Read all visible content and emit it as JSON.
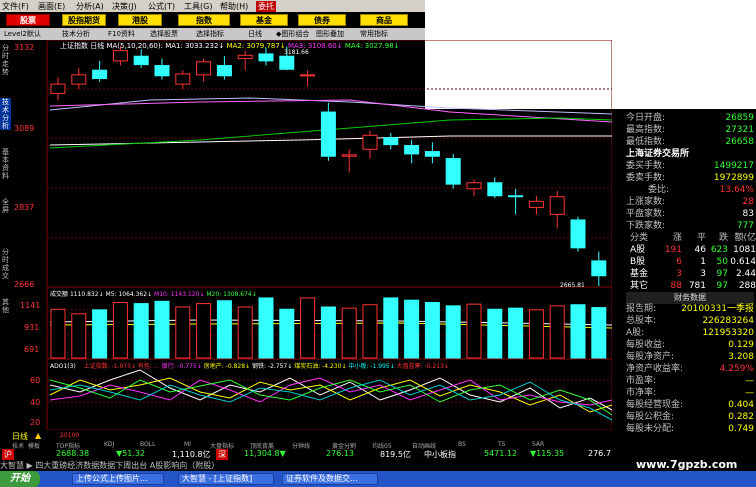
{
  "menu": [
    "文件(F)",
    "画面(E)",
    "分析(A)",
    "决策(J)",
    "公式(T)",
    "工具(G)",
    "帮助(H)",
    "委托"
  ],
  "tabs": [
    "股票",
    "股指期货",
    "港股",
    "指数",
    "基金",
    "债券",
    "商品"
  ],
  "toolbar": [
    "Level2默认",
    "技术分析",
    "F10资料",
    "选择股票",
    "选择指标",
    "日线",
    "◆图形组合",
    "图形叠加",
    "常用指标"
  ],
  "sidebar": [
    "分时走势",
    "技术分析",
    "基本资料",
    "全屏",
    "分时成交",
    "其他"
  ],
  "price_header": {
    "name": "上证指数",
    "period": "日线",
    "ma_label": "MA(5,10,20,60):",
    "ma1": "MA1: 3033.232↓",
    "ma2": "MA2: 3079.787↓",
    "ma3": "MA3: 3108.60↓",
    "ma4": "MA4: 3027.98↓",
    "high_mark": "3181.66",
    "low_mark": "2665.81"
  },
  "price_axis": [
    "3132",
    "3089",
    "2837",
    "2666"
  ],
  "volume_header": {
    "label": "成交额",
    "v1": "1110.832↓",
    "ma5": "M5: 1064.362↓",
    "ma10": "M10: 1143.120↓",
    "ma20": "M20: 1308.674↓"
  },
  "volume_axis": [
    "1141",
    "931",
    "691"
  ],
  "adl_header": {
    "label": "ADO1(3)",
    "items": [
      "上证指数: -1.973↓",
      "有色: ...",
      "银行: -0.775↓",
      "房地产: -0.828↓",
      "钢铁: -2.757↓",
      "煤炭石油: -4.230↓",
      "中小板: -1.995↓",
      "大盘蓝筹: -5.213↓"
    ]
  },
  "adl_axis": [
    "60",
    "40",
    "20"
  ],
  "bottom_date": "日线",
  "bottom_date2": "20100",
  "bottom_tabs": [
    "技术",
    "模板",
    "TOP指标",
    "KDJ",
    "BOLL",
    "MI",
    "大盘指标",
    "顶底背离",
    "分钟线",
    "黄金分割",
    "均线05",
    "自动画线",
    "BS",
    "TS",
    "SAR"
  ],
  "ticker": {
    "sh_label": "沪",
    "sh_val": "2688.38",
    "sh_chg": "▼51.32",
    "sh_amt": "1,110.8亿",
    "sz_label": "深",
    "sz_val": "11,304.8▼",
    "sz_chg": "276.13",
    "sz_amt": "819.5亿",
    "sme_label": "中小板指",
    "sme_val": "5471.12",
    "sme_chg": "▼115.35",
    "sme_amt": "276.7"
  },
  "news": "大智慧  ▶ 四大重磅经济数据数据下周出台 A股影响向（附股）",
  "right_panel": {
    "rows": [
      {
        "label": "今日开盘:",
        "value": "26859"
      },
      {
        "label": "最高指数:",
        "value": "27321"
      },
      {
        "label": "最低指数:",
        "value": "26658"
      }
    ],
    "exchange": "上海证券交易所",
    "rows2": [
      {
        "label": "委买手数:",
        "value": "1499217"
      },
      {
        "label": "委卖手数:",
        "value": "1972899"
      },
      {
        "label": "委比:",
        "value": "13.64%"
      },
      {
        "label": "上涨家数:",
        "value": "28"
      },
      {
        "label": "平盘家数:",
        "value": "83"
      },
      {
        "label": "下跌家数:",
        "value": "777"
      }
    ],
    "table_head": [
      "分类",
      "涨",
      "平",
      "跌",
      "额(亿"
    ],
    "table_rows": [
      [
        "A股",
        "191",
        "46",
        "623",
        "1081"
      ],
      [
        "B股",
        "6",
        "1",
        "50",
        "0.614"
      ],
      [
        "基金",
        "3",
        "3",
        "97",
        "2.44"
      ],
      [
        "其它",
        "88",
        "781",
        "97",
        "288"
      ]
    ],
    "fin_title": "财务数据",
    "fin_rows": [
      {
        "label": "报告期:",
        "value": "20100331一季报"
      },
      {
        "label": "总股本:",
        "value": "226283264"
      },
      {
        "label": "A股:",
        "value": "121953320"
      },
      {
        "label": "每股收益:",
        "value": "0.129"
      },
      {
        "label": "每股净资产:",
        "value": "3.208"
      },
      {
        "label": "净资产收益率:",
        "value": "4.259%"
      },
      {
        "label": "市盈率:",
        "value": "—"
      },
      {
        "label": "市净率:",
        "value": "—"
      },
      {
        "label": "每股经营现金:",
        "value": "0.404"
      },
      {
        "label": "每股公积金:",
        "value": "0.282"
      },
      {
        "label": "每股未分配:",
        "value": "0.749"
      }
    ]
  },
  "taskbar": {
    "start": "开始",
    "items": [
      "上传公式上传图片...",
      "大智慧 - [上证指数]",
      "证券软件及数据交..."
    ]
  },
  "watermark": "www.7gpzb.com",
  "chart_data": {
    "type": "candlestick",
    "title": "上证指数 日线",
    "ylim": [
      2666,
      3182
    ],
    "candles": [
      {
        "o": 3080,
        "h": 3115,
        "l": 3065,
        "c": 3100
      },
      {
        "o": 3100,
        "h": 3135,
        "l": 3090,
        "c": 3120
      },
      {
        "o": 3130,
        "h": 3150,
        "l": 3105,
        "c": 3112
      },
      {
        "o": 3150,
        "h": 3182,
        "l": 3140,
        "c": 3172
      },
      {
        "o": 3160,
        "h": 3175,
        "l": 3135,
        "c": 3142
      },
      {
        "o": 3140,
        "h": 3155,
        "l": 3110,
        "c": 3118
      },
      {
        "o": 3100,
        "h": 3130,
        "l": 3090,
        "c": 3122
      },
      {
        "o": 3120,
        "h": 3155,
        "l": 3105,
        "c": 3148
      },
      {
        "o": 3140,
        "h": 3160,
        "l": 3110,
        "c": 3118
      },
      {
        "o": 3155,
        "h": 3172,
        "l": 3130,
        "c": 3162
      },
      {
        "o": 3165,
        "h": 3178,
        "l": 3140,
        "c": 3150
      },
      {
        "o": 3160,
        "h": 3181,
        "l": 3130,
        "c": 3132
      },
      {
        "o": 3120,
        "h": 3130,
        "l": 3095,
        "c": 3120
      },
      {
        "o": 3040,
        "h": 3060,
        "l": 2935,
        "c": 2945
      },
      {
        "o": 2945,
        "h": 2960,
        "l": 2910,
        "c": 2948
      },
      {
        "o": 2960,
        "h": 3000,
        "l": 2940,
        "c": 2990
      },
      {
        "o": 2985,
        "h": 2995,
        "l": 2960,
        "c": 2970
      },
      {
        "o": 2968,
        "h": 2980,
        "l": 2930,
        "c": 2950
      },
      {
        "o": 2955,
        "h": 2975,
        "l": 2930,
        "c": 2945
      },
      {
        "o": 2940,
        "h": 2950,
        "l": 2875,
        "c": 2885
      },
      {
        "o": 2875,
        "h": 2895,
        "l": 2860,
        "c": 2888
      },
      {
        "o": 2888,
        "h": 2900,
        "l": 2855,
        "c": 2860
      },
      {
        "o": 2860,
        "h": 2875,
        "l": 2820,
        "c": 2858
      },
      {
        "o": 2835,
        "h": 2860,
        "l": 2820,
        "c": 2848
      },
      {
        "o": 2820,
        "h": 2870,
        "l": 2790,
        "c": 2858
      },
      {
        "o": 2808,
        "h": 2815,
        "l": 2740,
        "c": 2748
      },
      {
        "o": 2720,
        "h": 2740,
        "l": 2666,
        "c": 2688
      }
    ],
    "volume": [
      860,
      780,
      850,
      980,
      960,
      1000,
      900,
      960,
      1010,
      900,
      1060,
      860,
      1060,
      900,
      880,
      940,
      1060,
      1020,
      980,
      920,
      950,
      860,
      880,
      850,
      920,
      940,
      890
    ]
  }
}
